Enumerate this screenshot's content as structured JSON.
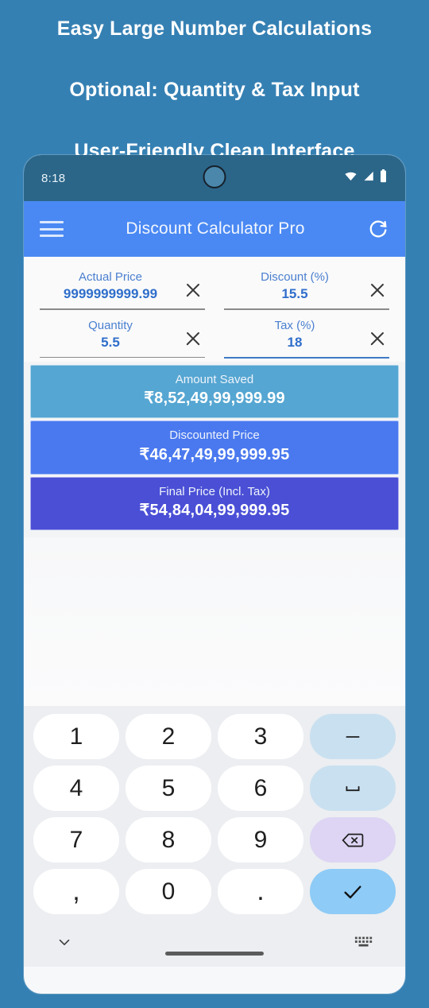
{
  "promo": {
    "lines": [
      "Easy Large Number Calculations",
      "Optional: Quantity & Tax Input",
      "User-Friendly Clean Interface"
    ]
  },
  "colors": {
    "page_background": "#3580b3",
    "status_bar": "#2b6689",
    "app_bar": "#4a89f3",
    "accent_blue": "#2f6ecb",
    "amount_saved_bar": "#55a6d2",
    "discounted_price_bar": "#4a79ef",
    "final_price_bar": "#4a4fd6",
    "keyboard_background": "#eceef1",
    "key_function": "#c9e0f0",
    "key_delete": "#ddd5f3",
    "key_enter": "#8ecbf7"
  },
  "status_bar": {
    "time": "8:18",
    "icons": [
      "wifi-icon",
      "cellular-signal-icon",
      "battery-icon"
    ]
  },
  "app_bar": {
    "menu_icon": "hamburger-menu-icon",
    "title": "Discount Calculator Pro",
    "refresh_icon": "refresh-icon"
  },
  "inputs": {
    "clear_icon": "clear-x-icon",
    "fields": [
      {
        "label": "Actual Price",
        "value": "9999999999.99",
        "focused": false
      },
      {
        "label": "Discount (%)",
        "value": "15.5",
        "focused": false
      },
      {
        "label": "Quantity",
        "value": "5.5",
        "focused": false
      },
      {
        "label": "Tax (%)",
        "value": "18",
        "focused": true
      }
    ]
  },
  "results": [
    {
      "label": "Amount Saved",
      "value": "₹8,52,49,99,999.99",
      "color": "#55a6d2"
    },
    {
      "label": "Discounted Price",
      "value": "₹46,47,49,99,999.95",
      "color": "#4a79ef"
    },
    {
      "label": "Final Price (Incl. Tax)",
      "value": "₹54,84,04,99,999.95",
      "color": "#4a4fd6"
    }
  ],
  "keyboard": {
    "rows": [
      [
        {
          "label": "1",
          "type": "digit"
        },
        {
          "label": "2",
          "type": "digit"
        },
        {
          "label": "3",
          "type": "digit"
        },
        {
          "label": "–",
          "type": "minus"
        }
      ],
      [
        {
          "label": "4",
          "type": "digit"
        },
        {
          "label": "5",
          "type": "digit"
        },
        {
          "label": "6",
          "type": "digit"
        },
        {
          "label": "␣",
          "type": "space"
        }
      ],
      [
        {
          "label": "7",
          "type": "digit"
        },
        {
          "label": "8",
          "type": "digit"
        },
        {
          "label": "9",
          "type": "digit"
        },
        {
          "label": "⌫",
          "type": "backspace"
        }
      ],
      [
        {
          "label": ",",
          "type": "comma"
        },
        {
          "label": "0",
          "type": "digit"
        },
        {
          "label": ".",
          "type": "dot"
        },
        {
          "label": "✓",
          "type": "enter"
        }
      ]
    ],
    "footer": {
      "hide_icon": "chevron-down-icon",
      "switch_icon": "keyboard-switch-icon",
      "home_indicator": "home-indicator"
    }
  }
}
